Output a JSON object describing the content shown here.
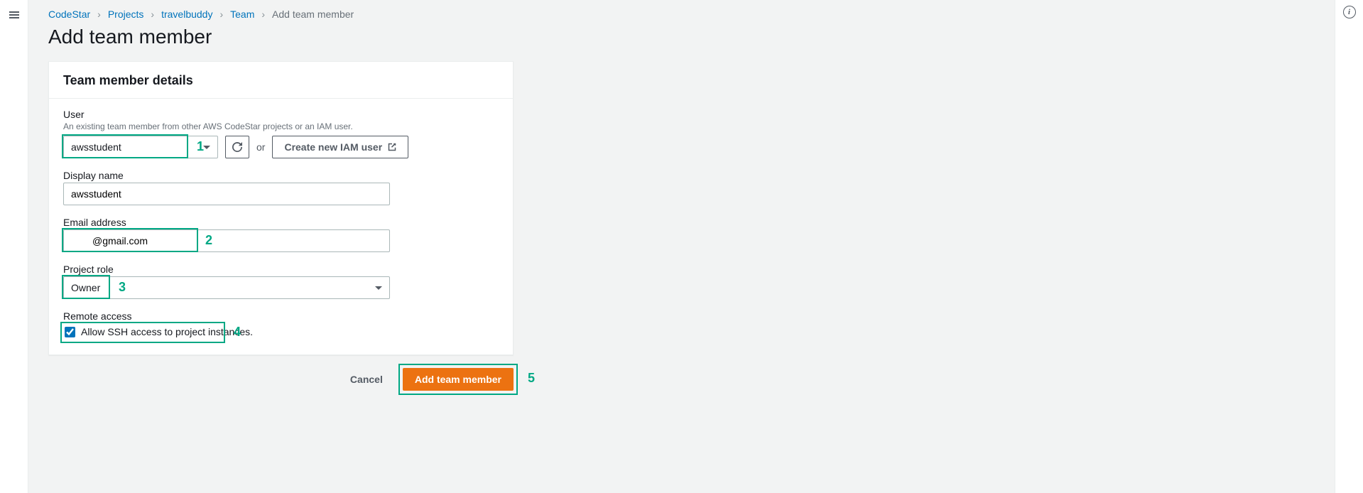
{
  "breadcrumb": {
    "items": [
      "CodeStar",
      "Projects",
      "travelbuddy",
      "Team"
    ],
    "current": "Add team member"
  },
  "page": {
    "title": "Add team member"
  },
  "panel": {
    "title": "Team member details",
    "user": {
      "label": "User",
      "hint": "An existing team member from other AWS CodeStar projects or an IAM user.",
      "value": "awsstudent",
      "or": "or",
      "create_btn": "Create new IAM user"
    },
    "display_name": {
      "label": "Display name",
      "value": "awsstudent"
    },
    "email": {
      "label": "Email address",
      "value": "@gmail.com"
    },
    "role": {
      "label": "Project role",
      "value": "Owner"
    },
    "remote": {
      "label": "Remote access",
      "checkbox_label": "Allow SSH access to project instances.",
      "checked": true
    }
  },
  "actions": {
    "cancel": "Cancel",
    "submit": "Add team member"
  },
  "annotations": {
    "n1": "1",
    "n2": "2",
    "n3": "3",
    "n4": "4",
    "n5": "5"
  }
}
